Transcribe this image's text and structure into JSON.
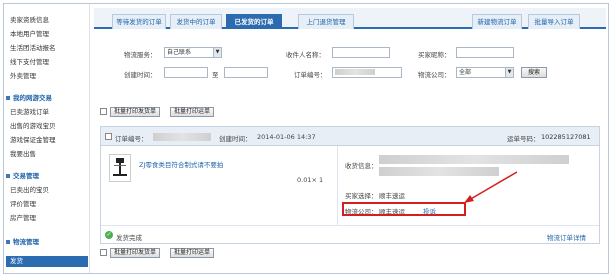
{
  "sidebar": {
    "items_top": [
      "卖家资质信息",
      "本地用户管理",
      "生活团活动报名",
      "线下支付管理",
      "外卖管理"
    ],
    "section1": {
      "title": "我的网游交易",
      "items": [
        "已卖游戏订单",
        "出售的游戏宝贝",
        "游戏保证金管理",
        "我要出售"
      ]
    },
    "section2": {
      "title": "交易管理",
      "items": [
        "已卖出的宝贝",
        "评价管理",
        "房产管理"
      ]
    },
    "section3": {
      "title": "物流管理",
      "active_item": "发货"
    }
  },
  "tabs": [
    {
      "label": "等待发货的订单"
    },
    {
      "label": "发货中的订单"
    },
    {
      "label": "已发货的订单"
    },
    {
      "label": "上门退货管理"
    },
    {
      "label": "新建物流订单"
    },
    {
      "label": "批量导入订单"
    }
  ],
  "search": {
    "logistics_service_label": "物流服务：",
    "logistics_service_value": "自己联系",
    "receiver_label": "收件人名称：",
    "buyer_label": "买家昵称：",
    "created_label": "创建时间：",
    "to_label": "至",
    "order_no_label": "订单编号：",
    "company_label": "物流公司：",
    "company_value": "全部",
    "search_button": "搜索"
  },
  "batch": {
    "print_shipping_label": "批量打印发货单",
    "print_waybill_label": "批量打印运单"
  },
  "order": {
    "order_no_label": "订单编号：",
    "created_label": "创建时间：",
    "created_value": "2014-01-06 14:37",
    "waybill_label": "运单号码：",
    "waybill_value": "102285127081",
    "product_title": "ZJ零食类目符合制式请不要拍",
    "price_qty": "0.01× 1",
    "receiver_info_label": "收货信息：",
    "buyer_choice_label": "买家选择：",
    "buyer_choice_value": "顺丰速运",
    "logistics_company_label": "物流公司：",
    "logistics_company_value": "顺丰速运",
    "complaint_link": "投诉",
    "status": "发货完成",
    "details_link": "物流订单详情"
  }
}
